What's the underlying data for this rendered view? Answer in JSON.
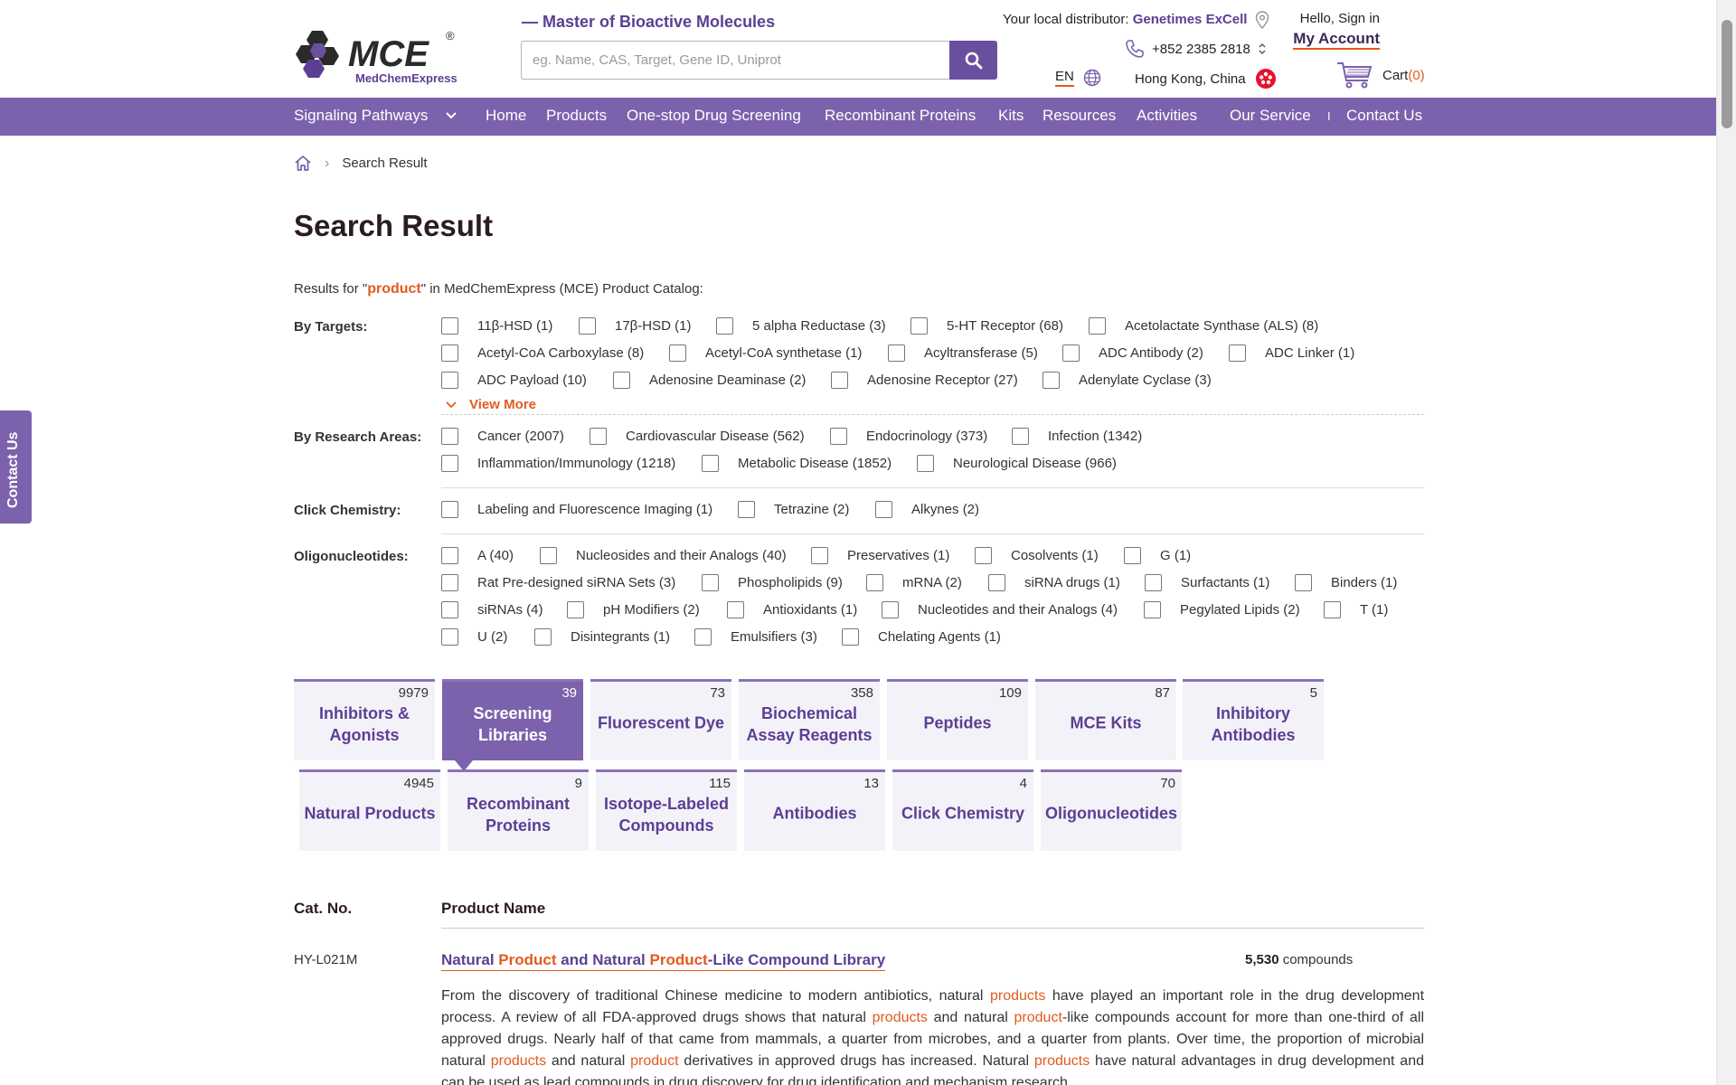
{
  "header": {
    "logo_text": "MCE",
    "logo_sub": "MedChemExpress",
    "tagline": "— Master of Bioactive Molecules",
    "search_placeholder": "eg. Name, CAS, Target, Gene ID, Uniprot",
    "distributor_label": "Your local distributor:",
    "distributor_name": "Genetimes ExCell",
    "phone": "+852 2385 2818",
    "language": "EN",
    "region": "Hong Kong, China",
    "greeting": "Hello, Sign in",
    "account_label": "My Account",
    "cart_label": "Cart",
    "cart_count": "(0)"
  },
  "nav": {
    "signaling": "Signaling Pathways",
    "home": "Home",
    "products": "Products",
    "drug_screening": "One-stop Drug Screening",
    "recombinant": "Recombinant Proteins",
    "kits": "Kits",
    "resources": "Resources",
    "activities": "Activities",
    "our_service": "Our Service",
    "separator": "I",
    "contact": "Contact Us"
  },
  "contact_tab": "Contact Us",
  "breadcrumb": {
    "current": "Search Result"
  },
  "page_title": "Search Result",
  "results": {
    "prefix": "Results for \"",
    "keyword": "product",
    "suffix": "\" in MedChemExpress (MCE) Product Catalog:"
  },
  "filters": {
    "targets_label": "By Targets:",
    "targets": [
      "11β-HSD (1)",
      "17β-HSD (1)",
      "5 alpha Reductase (3)",
      "5-HT Receptor (68)",
      "Acetolactate Synthase (ALS) (8)",
      "Acetyl-CoA Carboxylase (8)",
      "Acetyl-CoA synthetase (1)",
      "Acyltransferase (5)",
      "ADC Antibody (2)",
      "ADC Linker (1)",
      "ADC Payload (10)",
      "Adenosine Deaminase (2)",
      "Adenosine Receptor (27)",
      "Adenylate Cyclase (3)"
    ],
    "view_more": "View More",
    "research_label": "By Research Areas:",
    "research": [
      "Cancer (2007)",
      "Cardiovascular Disease (562)",
      "Endocrinology (373)",
      "Infection (1342)",
      "Inflammation/Immunology (1218)",
      "Metabolic Disease (1852)",
      "Neurological Disease (966)"
    ],
    "click_label": "Click Chemistry:",
    "click": [
      "Labeling and Fluorescence Imaging (1)",
      "Tetrazine (2)",
      "Alkynes (2)"
    ],
    "oligo_label": "Oligonucleotides:",
    "oligo": [
      "A (40)",
      "Nucleosides and their Analogs (40)",
      "Preservatives (1)",
      "Cosolvents (1)",
      "G (1)",
      "Rat Pre-designed siRNA Sets (3)",
      "Phospholipids (9)",
      "mRNA (2)",
      "siRNA drugs (1)",
      "Surfactants (1)",
      "Binders (1)",
      "siRNAs (4)",
      "pH Modifiers (2)",
      "Antioxidants (1)",
      "Nucleotides and their Analogs (4)",
      "Pegylated Lipids (2)",
      "T (1)",
      "U (2)",
      "Disintegrants (1)",
      "Emulsifiers (3)",
      "Chelating Agents (1)"
    ]
  },
  "tabs": [
    {
      "label": "Inhibitors & Agonists",
      "count": "9979",
      "active": false
    },
    {
      "label": "Screening Libraries",
      "count": "39",
      "active": true
    },
    {
      "label": "Fluorescent Dye",
      "count": "73",
      "active": false
    },
    {
      "label": "Biochemical Assay Reagents",
      "count": "358",
      "active": false
    },
    {
      "label": "Peptides",
      "count": "109",
      "active": false
    },
    {
      "label": "MCE Kits",
      "count": "87",
      "active": false
    },
    {
      "label": "Inhibitory Antibodies",
      "count": "5",
      "active": false
    },
    {
      "label": "Natural Products",
      "count": "4945",
      "active": false
    },
    {
      "label": "Recombinant Proteins",
      "count": "9",
      "active": false
    },
    {
      "label": "Isotope-Labeled Compounds",
      "count": "115",
      "active": false
    },
    {
      "label": "Antibodies",
      "count": "13",
      "active": false
    },
    {
      "label": "Click Chemistry",
      "count": "4",
      "active": false
    },
    {
      "label": "Oligonucleotides",
      "count": "70",
      "active": false
    }
  ],
  "table": {
    "col_cat": "Cat. No.",
    "col_name": "Product Name",
    "rows": [
      {
        "cat_no": "HY-L021M",
        "title_parts": [
          "Natural ",
          "Product",
          " and Natural ",
          "Product",
          "-Like Compound Library"
        ],
        "compounds_num": "5,530",
        "compounds_label": " compounds",
        "desc_parts": [
          "From the discovery of traditional Chinese medicine to modern antibiotics, natural ",
          "products",
          " have played an important role in the drug development process. A review of all FDA-approved drugs shows that natural ",
          "products",
          " and natural ",
          "product",
          "-like compounds account for more than one-third of all approved drugs. Nearly half of that came from mammals, a quarter from microbes, and a quarter from plants. Over time, the proportion of microbial natural ",
          "products",
          " and natural ",
          "product",
          " derivatives in approved drugs has increased. Natural ",
          "products",
          " have natural advantages in drug development and can be used as lead compounds in drug discovery for drug identification and mechanism research."
        ]
      }
    ]
  },
  "colors": {
    "brand": "#7c62ac",
    "brand_dark": "#5b3f93",
    "accent": "#e35a1f"
  }
}
